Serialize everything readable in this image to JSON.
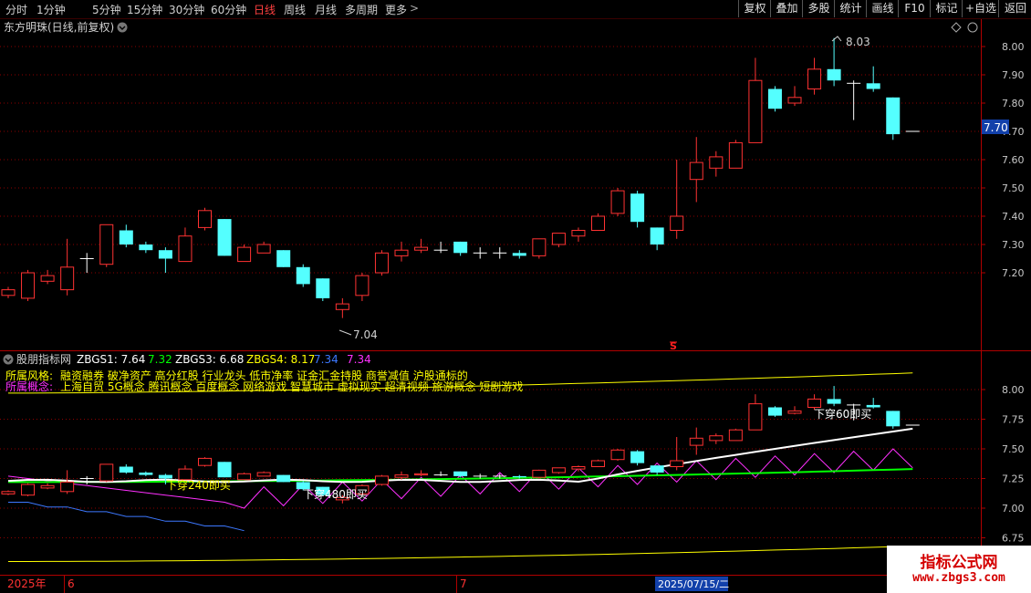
{
  "toolbar": {
    "periods": [
      "分时",
      "1分钟",
      "5分钟",
      "15分钟",
      "30分钟",
      "60分钟",
      "日线",
      "周线",
      "月线",
      "多周期",
      "更多"
    ],
    "active_period": "日线",
    "more_chevron": ">",
    "buttons": [
      "复权",
      "叠加",
      "多股",
      "统计",
      "画线",
      "F10",
      "标记",
      "+自选",
      "返回"
    ]
  },
  "main_chart": {
    "title": "东方明珠(日线,前复权)",
    "title_chevron_icon": "chevron-down-circle-icon",
    "diamond_icon": "diamond-icon",
    "high_label": "8.03",
    "low_label": "7.04",
    "last_price_label": "7.70",
    "signal_mark": "S",
    "y_ticks": [
      "8.00",
      "7.90",
      "7.80",
      "7.70",
      "7.60",
      "7.50",
      "7.40",
      "7.30",
      "7.20"
    ],
    "colors": {
      "up": "#ff3232",
      "down": "#54ffff",
      "grid": "#8b0000",
      "axis": "#b00000",
      "text": "#c8c8c8"
    }
  },
  "indicator": {
    "name": "股朋指标网",
    "fields": [
      {
        "label": "ZBGS1: 7.64",
        "color": "#ffffff"
      },
      {
        "label": "7.32",
        "color": "#00ff00"
      },
      {
        "label": "ZBGS3: 6.68",
        "color": "#ffffff"
      },
      {
        "label": "ZBGS4: 8.17",
        "color": "#ffff00"
      },
      {
        "label": "7.34",
        "color": "#3c78ff"
      },
      {
        "label": "7.34",
        "color": "#ff30ff"
      }
    ],
    "style_label": "所属风格:",
    "style_text": "融资融券 破净资产 高分红股 行业龙头 低市净率 证金汇金持股 商誉减值 沪股通标的",
    "concept_label": "所属概念:",
    "concept_text": "上海自贸 5G概念 腾讯概念 百度概念 网络游戏 智慧城市 虚拟现实 超清视频 旅游概念 短剧游戏",
    "annotations": [
      "下穿240即买",
      "下穿480即买",
      "下穿60即买"
    ],
    "y_ticks": [
      "8.00",
      "7.75",
      "7.50",
      "7.25",
      "7.00",
      "6.75"
    ]
  },
  "date_axis": {
    "year": "2025年",
    "month6": "6",
    "month7": "7",
    "cursor_date": "2025/07/15/二"
  },
  "chart_data": {
    "type": "candlestick",
    "title": "东方明珠(日线,前复权)",
    "ylim": [
      7.1,
      8.08
    ],
    "candles": [
      {
        "o": 7.12,
        "c": 7.14,
        "h": 7.15,
        "l": 7.11
      },
      {
        "o": 7.11,
        "c": 7.2,
        "h": 7.21,
        "l": 7.1
      },
      {
        "o": 7.17,
        "c": 7.19,
        "h": 7.21,
        "l": 7.16
      },
      {
        "o": 7.14,
        "c": 7.22,
        "h": 7.32,
        "l": 7.12
      },
      {
        "o": 7.25,
        "c": 7.25,
        "h": 7.27,
        "l": 7.2
      },
      {
        "o": 7.23,
        "c": 7.37,
        "h": 7.37,
        "l": 7.22
      },
      {
        "o": 7.35,
        "c": 7.3,
        "h": 7.37,
        "l": 7.29
      },
      {
        "o": 7.3,
        "c": 7.28,
        "h": 7.31,
        "l": 7.27
      },
      {
        "o": 7.28,
        "c": 7.25,
        "h": 7.29,
        "l": 7.2
      },
      {
        "o": 7.24,
        "c": 7.33,
        "h": 7.36,
        "l": 7.24
      },
      {
        "o": 7.36,
        "c": 7.42,
        "h": 7.43,
        "l": 7.35
      },
      {
        "o": 7.39,
        "c": 7.26,
        "h": 7.39,
        "l": 7.26
      },
      {
        "o": 7.24,
        "c": 7.29,
        "h": 7.3,
        "l": 7.24
      },
      {
        "o": 7.27,
        "c": 7.3,
        "h": 7.31,
        "l": 7.27
      },
      {
        "o": 7.28,
        "c": 7.22,
        "h": 7.28,
        "l": 7.22
      },
      {
        "o": 7.22,
        "c": 7.16,
        "h": 7.23,
        "l": 7.15
      },
      {
        "o": 7.18,
        "c": 7.11,
        "h": 7.18,
        "l": 7.1
      },
      {
        "o": 7.07,
        "c": 7.09,
        "h": 7.11,
        "l": 7.04
      },
      {
        "o": 7.12,
        "c": 7.19,
        "h": 7.2,
        "l": 7.1
      },
      {
        "o": 7.2,
        "c": 7.27,
        "h": 7.28,
        "l": 7.19
      },
      {
        "o": 7.26,
        "c": 7.28,
        "h": 7.31,
        "l": 7.24
      },
      {
        "o": 7.28,
        "c": 7.29,
        "h": 7.32,
        "l": 7.27
      },
      {
        "o": 7.28,
        "c": 7.28,
        "h": 7.31,
        "l": 7.27
      },
      {
        "o": 7.31,
        "c": 7.27,
        "h": 7.31,
        "l": 7.26
      },
      {
        "o": 7.27,
        "c": 7.27,
        "h": 7.29,
        "l": 7.25
      },
      {
        "o": 7.27,
        "c": 7.27,
        "h": 7.29,
        "l": 7.25
      },
      {
        "o": 7.27,
        "c": 7.26,
        "h": 7.28,
        "l": 7.25
      },
      {
        "o": 7.26,
        "c": 7.32,
        "h": 7.32,
        "l": 7.25
      },
      {
        "o": 7.3,
        "c": 7.34,
        "h": 7.34,
        "l": 7.29
      },
      {
        "o": 7.33,
        "c": 7.35,
        "h": 7.36,
        "l": 7.31
      },
      {
        "o": 7.35,
        "c": 7.4,
        "h": 7.41,
        "l": 7.35
      },
      {
        "o": 7.41,
        "c": 7.49,
        "h": 7.5,
        "l": 7.4
      },
      {
        "o": 7.48,
        "c": 7.38,
        "h": 7.49,
        "l": 7.36
      },
      {
        "o": 7.36,
        "c": 7.3,
        "h": 7.36,
        "l": 7.28
      },
      {
        "o": 7.35,
        "c": 7.4,
        "h": 7.6,
        "l": 7.32
      },
      {
        "o": 7.53,
        "c": 7.59,
        "h": 7.68,
        "l": 7.45
      },
      {
        "o": 7.57,
        "c": 7.61,
        "h": 7.63,
        "l": 7.54
      },
      {
        "o": 7.57,
        "c": 7.66,
        "h": 7.67,
        "l": 7.57
      },
      {
        "o": 7.66,
        "c": 7.88,
        "h": 7.96,
        "l": 7.66
      },
      {
        "o": 7.85,
        "c": 7.78,
        "h": 7.86,
        "l": 7.77
      },
      {
        "o": 7.8,
        "c": 7.82,
        "h": 7.86,
        "l": 7.79
      },
      {
        "o": 7.85,
        "c": 7.92,
        "h": 7.96,
        "l": 7.83
      },
      {
        "o": 7.92,
        "c": 7.88,
        "h": 8.03,
        "l": 7.86
      },
      {
        "o": 7.87,
        "c": 7.87,
        "h": 7.88,
        "l": 7.74
      },
      {
        "o": 7.87,
        "c": 7.85,
        "h": 7.93,
        "l": 7.84
      },
      {
        "o": 7.82,
        "c": 7.69,
        "h": 7.82,
        "l": 7.67
      },
      {
        "o": 7.7,
        "c": 7.7,
        "h": 7.7,
        "l": 7.7
      }
    ]
  }
}
